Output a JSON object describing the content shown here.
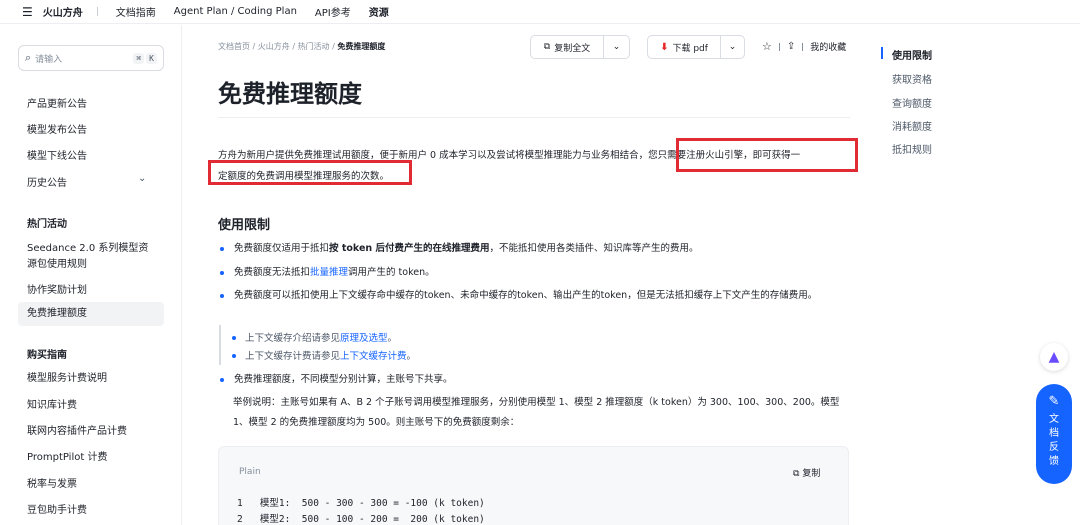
{
  "topnav": {
    "brand": "火山方舟",
    "items": [
      "文档指南",
      "Agent Plan / Coding Plan",
      "API参考",
      "资源"
    ]
  },
  "sidebar": {
    "search_placeholder": "请输入",
    "shortcut": [
      "⌘",
      "K"
    ],
    "items": [
      "产品更新公告",
      "模型发布公告",
      "模型下线公告",
      "历史公告"
    ],
    "group1": "热门活动",
    "group1_items": [
      "Seedance 2.0 系列模型资",
      "源包使用规则",
      "协作奖励计划",
      "免费推理额度"
    ],
    "group2": "购买指南",
    "group2_items": [
      "模型服务计费说明",
      "知识库计费",
      "联网内容插件产品计费",
      "PromptPilot 计费",
      "税率与发票",
      "豆包助手计费"
    ]
  },
  "breadcrumb": [
    "文档首页",
    "火山方舟",
    "热门活动",
    "免费推理额度"
  ],
  "toolbar": {
    "copy_label": "复制全文",
    "pdf_label": "下载 pdf",
    "favorite_label": "我的收藏"
  },
  "page": {
    "title": "免费推理额度",
    "intro_a": "方舟为新用户提供免费推理试用额度，便于新用户 0 成本学习以及尝试将模型推理能力与业务相结合，",
    "intro_b": "您只需要注册火山引擎，即可获得一",
    "intro_c": "定额度的免费调用模型推理服务的次数。",
    "section_title": "使用限制",
    "b1_pre": "免费额度仅适用于抵扣",
    "b1_bold": "按 token 后付费产生的在线推理费用",
    "b1_post": "，不能抵扣使用各类插件、知识库等产生的费用。",
    "b2_pre": "免费额度无法抵扣",
    "b2_link": "批量推理",
    "b2_post": "调用产生的 token。",
    "b3": "免费额度可以抵扣使用上下文缓存命中缓存的token、未命中缓存的token、输出产生的token，但是无法抵扣缓存上下文产生的存储费用。",
    "sub1_pre": "上下文缓存介绍请参见",
    "sub1_link": "原理及选型",
    "sub1_post": "。",
    "sub2_pre": "上下文缓存计费请参见",
    "sub2_link": "上下文缓存计费",
    "sub2_post": "。",
    "b4": "免费推理额度，不同模型分别计算，主账号下共享。",
    "example": "举例说明：主账号如果有 A、B 2 个子账号调用模型推理服务，分别使用模型 1、模型 2 推理额度（k token）为 300、100、300、200。模型 1、模型 2 的免费推理额度均为 500。则主账号下的免费额度剩余：",
    "code_lang": "Plain",
    "code_copy": "复制",
    "code_lines": [
      "1   模型1:  500 - 300 - 300 = -100 (k token)",
      "2   模型2:  500 - 100 - 200 =  200 (k token)"
    ]
  },
  "toc": [
    "使用限制",
    "获取资格",
    "查询额度",
    "消耗额度",
    "抵扣规则"
  ],
  "feedback": [
    "文",
    "档",
    "反",
    "馈"
  ],
  "colors": {
    "accent": "#1664ff",
    "highlight": "#e02b34"
  }
}
